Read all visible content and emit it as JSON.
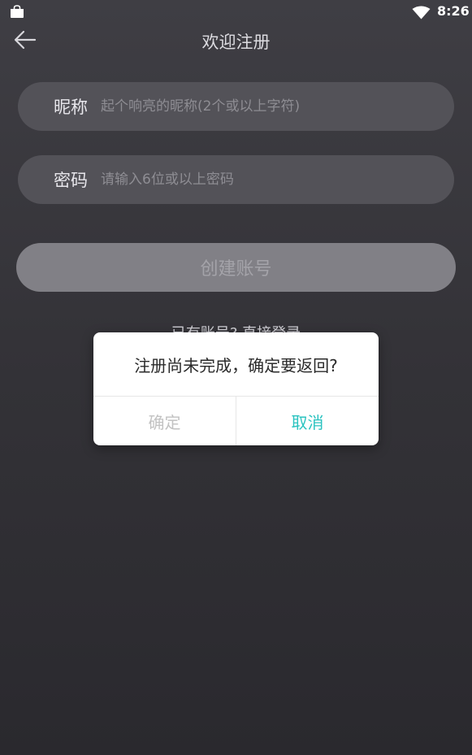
{
  "status_bar": {
    "time": "8:26",
    "left_icon": "shopping-bag-icon",
    "wifi_icon": "wifi-icon"
  },
  "header": {
    "back_icon": "arrow-left-icon",
    "title": "欢迎注册"
  },
  "form": {
    "nickname": {
      "label": "昵称",
      "value": "",
      "placeholder": "起个响亮的昵称(2个或以上字符)"
    },
    "password": {
      "label": "密码",
      "value": "",
      "placeholder": "请输入6位或以上密码"
    },
    "create_button_label": "创建账号"
  },
  "login_link": "已有账号? 直接登录",
  "dialog": {
    "message": "注册尚未完成，确定要返回?",
    "confirm_label": "确定",
    "cancel_label": "取消"
  },
  "colors": {
    "accent": "#2bc3c0",
    "background": "#343338",
    "field_background": "#535258",
    "button_disabled": "#818086"
  }
}
